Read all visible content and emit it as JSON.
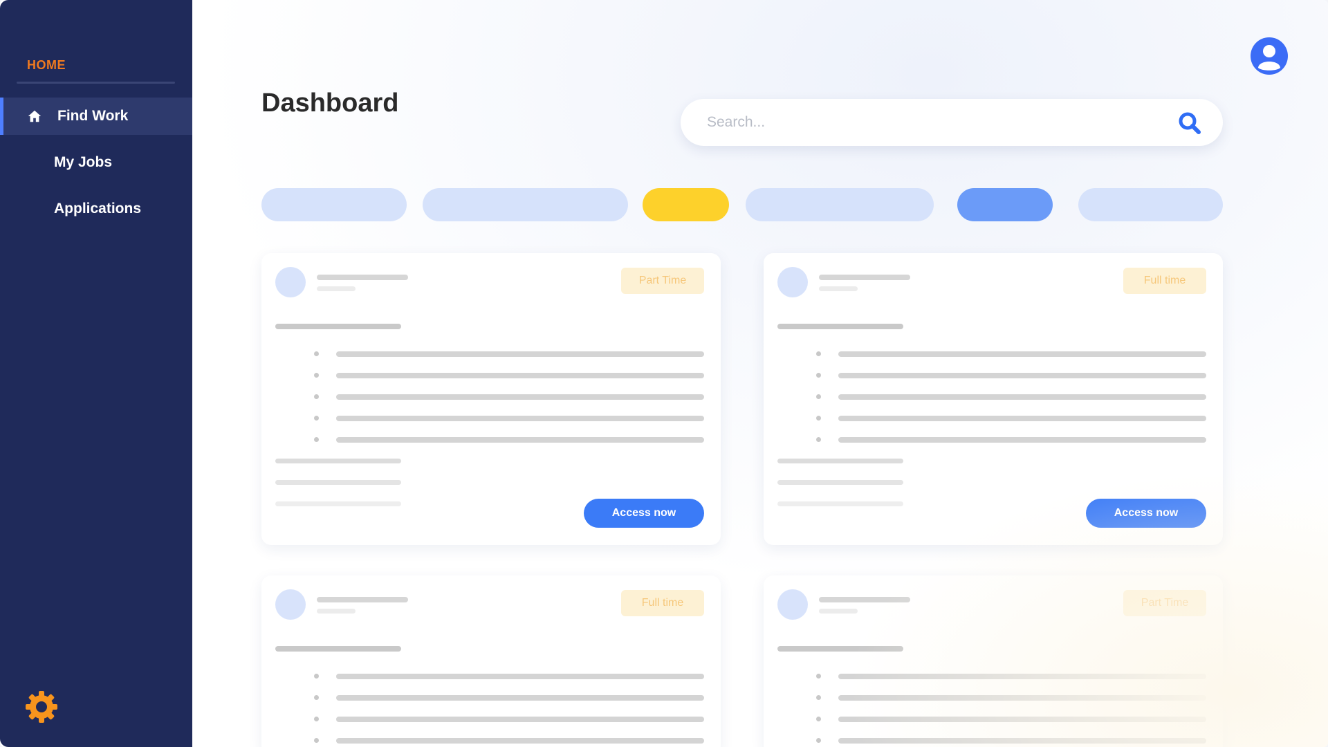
{
  "sidebar": {
    "heading": "HOME",
    "items": [
      {
        "label": "Find Work",
        "icon": "home-icon",
        "active": true
      },
      {
        "label": "My Jobs",
        "icon": "",
        "active": false
      },
      {
        "label": "Applications",
        "icon": "",
        "active": false
      }
    ],
    "settings_icon": "gear-icon"
  },
  "header": {
    "title": "Dashboard",
    "avatar_icon": "user-icon"
  },
  "search": {
    "placeholder": "Search...",
    "value": "",
    "icon": "search-icon"
  },
  "filters": [
    {
      "color": "#d6e2fb",
      "selected": false
    },
    {
      "color": "#d6e2fb",
      "selected": false
    },
    {
      "color": "#fdd12b",
      "selected": true
    },
    {
      "color": "#d6e2fb",
      "selected": false
    },
    {
      "color": "#6b9bf8",
      "selected": true
    },
    {
      "color": "#d6e2fb",
      "selected": false
    }
  ],
  "cards": [
    {
      "tag": "Part Time",
      "button": "Access now"
    },
    {
      "tag": "Full time",
      "button": "Access now"
    },
    {
      "tag": "Full time",
      "button": ""
    },
    {
      "tag": "Part Time",
      "button": ""
    }
  ],
  "colors": {
    "sidebar_bg": "#1f2a5a",
    "accent_orange": "#f07a1f",
    "primary_blue": "#3b7bf7",
    "tag_bg": "#fdf1d4",
    "tag_text": "#f6c77a"
  }
}
